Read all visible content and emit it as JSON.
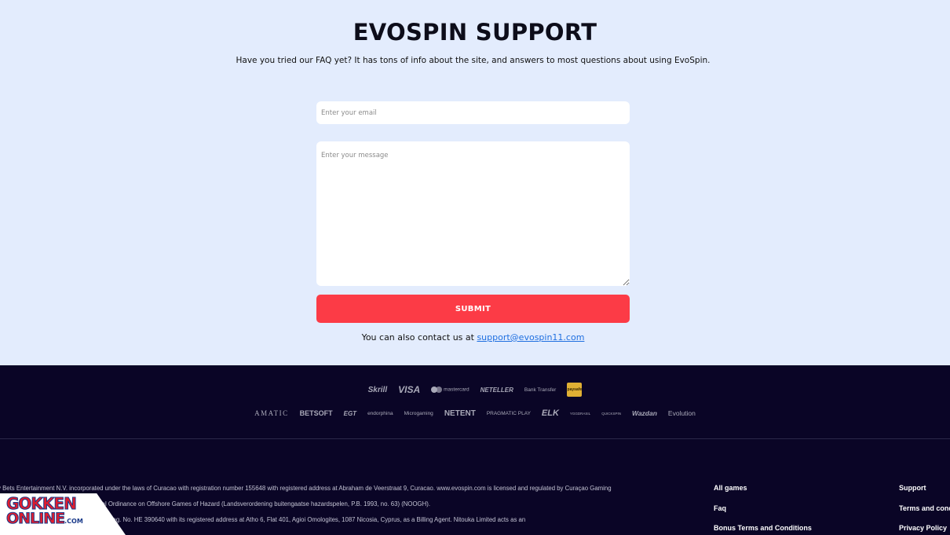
{
  "header": {
    "title": "EVOSPIN SUPPORT",
    "subtitle": "Have you tried our FAQ yet? It has tons of info about the site, and answers to most questions about using EvoSpin."
  },
  "form": {
    "email_placeholder": "Enter your email",
    "message_placeholder": "Enter your message",
    "submit_label": "SUBMIT"
  },
  "contact": {
    "text": "You can also contact us at ",
    "email": "support@evospin11.com"
  },
  "payments": [
    "Skrill",
    "VISA",
    "mastercard",
    "NETELLER",
    "Bank Transfer",
    "paysafe"
  ],
  "providers": [
    "AMATIC",
    "BETSOFT",
    "EGT",
    "endorphina",
    "Microgaming",
    "NETENT",
    "PRAGMATIC PLAY",
    "ELK",
    "YGGDRASIL",
    "QUICKSPIN",
    "Wazdan",
    "Evolution"
  ],
  "legal": {
    "line1": "y Bets Entertainment N.V. incorporated under the laws of Curacao with registration number 155648 with registered address at Abraham de Veerstraat 9, Curacao. www.evospin.com is licensed and regulated by Curaçao Gaming",
    "line2": "78/0479 in accordance with the National Ordinance on Offshore Games of Hazard (Landsverordening buitengaatse hazardspelen, P.B. 1993, no. 63) (NOOGH).",
    "line3": "tablished under the laws of Cyprus under reg. No. HE 390640 with its registered address at Atho 6, Flat 401, Agioi Omologites, 1087 Nicosia, Cyprus, as a Billing Agent. Nitouka Limited acts as an"
  },
  "footer_links": {
    "col1": [
      "All games",
      "Faq",
      "Bonus Terms and Conditions"
    ],
    "col2": [
      "Support",
      "Terms and conditions",
      "Privacy Policy"
    ]
  },
  "watermark": {
    "line1": "GOKKEN",
    "line2": "ONLINE",
    "suffix": ".COM"
  },
  "colors": {
    "background": "#e3ecfd",
    "footer": "#0a0526",
    "submit": "#fc3b46",
    "link": "#1f6fe0"
  }
}
